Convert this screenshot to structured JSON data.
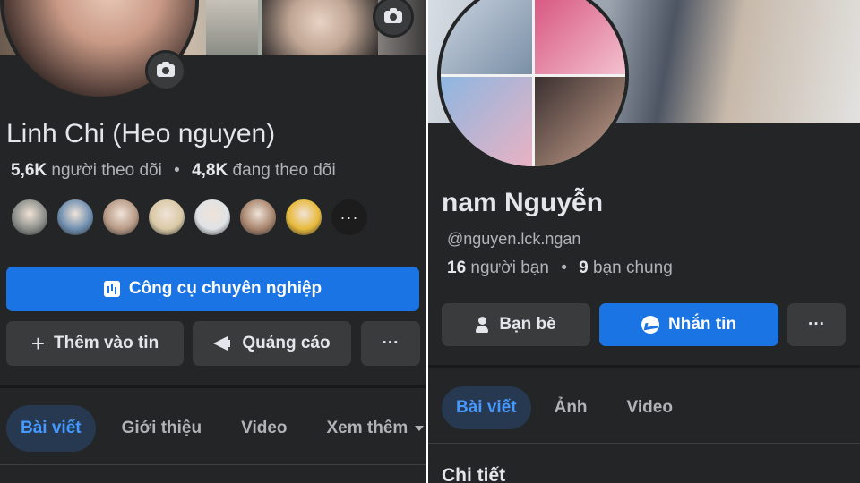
{
  "left_profile": {
    "name": "Linh Chi (Heo nguyen)",
    "followers_count": "5,6K",
    "followers_label": "người theo dõi",
    "separator": "•",
    "following_count": "4,8K",
    "following_label": "đang theo dõi",
    "more_friends_label": "···",
    "friend_avatars": [
      {
        "icon": "avatar-1",
        "color": "#8c8f8a"
      },
      {
        "icon": "avatar-2",
        "color": "#6f8fb0"
      },
      {
        "icon": "avatar-3",
        "color": "#b89a86"
      },
      {
        "icon": "avatar-4",
        "color": "#d9c9a6"
      },
      {
        "icon": "avatar-5",
        "color": "#dfe3e6"
      },
      {
        "icon": "avatar-6",
        "color": "#a9866e"
      },
      {
        "icon": "avatar-7",
        "color": "#e8b93a"
      }
    ],
    "buttons": {
      "pro_tools": "Công cụ chuyên nghiệp",
      "add_story": "Thêm vào tin",
      "ads": "Quảng cáo",
      "more": "···"
    },
    "tabs": [
      "Bài viết",
      "Giới thiệu",
      "Video",
      "Xem thêm"
    ]
  },
  "right_profile": {
    "name": "nam Nguyễn",
    "handle": "@nguyen.lck.ngan",
    "friends_count": "16",
    "friends_label": "người bạn",
    "separator": "•",
    "mutual_count": "9",
    "mutual_label": "bạn chung",
    "buttons": {
      "friends": "Bạn bè",
      "message": "Nhắn tin",
      "more": "···"
    },
    "tabs": [
      "Bài viết",
      "Ảnh",
      "Video"
    ],
    "section_title": "Chi tiết"
  },
  "colors": {
    "background": "#242526",
    "primary": "#1b74e4",
    "secondary_button": "#3a3b3c",
    "active_tab_bg": "#263951",
    "active_tab_text": "#4599ff",
    "text_primary": "#e4e6eb",
    "text_secondary": "#b0b3b8"
  }
}
